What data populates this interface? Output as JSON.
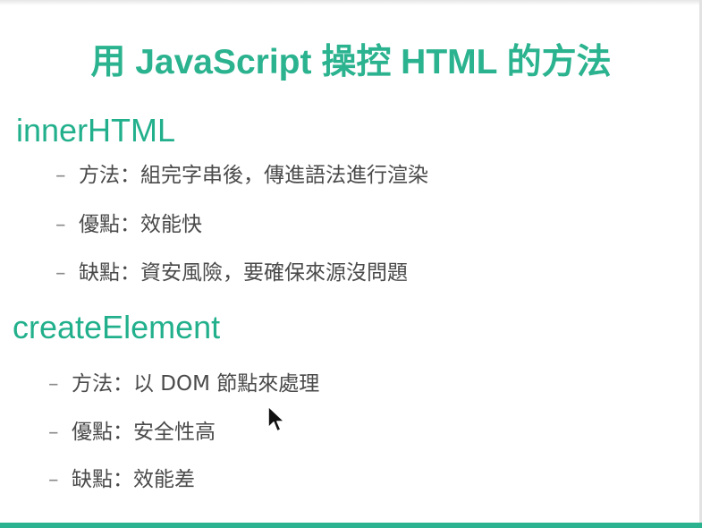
{
  "slide": {
    "title": "用 JavaScript 操控 HTML 的方法",
    "sections": [
      {
        "heading": "innerHTML",
        "bullets": [
          {
            "dash": "–",
            "text": "方法：組完字串後，傳進語法進行渲染"
          },
          {
            "dash": "–",
            "text": "優點：效能快"
          },
          {
            "dash": "–",
            "text": "缺點：資安風險，要確保來源沒問題"
          }
        ]
      },
      {
        "heading": "createElement",
        "bullets": [
          {
            "dash": "–",
            "text": "方法：以 DOM 節點來處理"
          },
          {
            "dash": "–",
            "text": "優點：安全性高"
          },
          {
            "dash": "–",
            "text": "缺點：效能差"
          }
        ]
      }
    ]
  },
  "colors": {
    "accent": "#2bb38f",
    "body_text": "#4a4a4a"
  },
  "icons": {
    "cursor": "mouse-pointer-icon"
  }
}
